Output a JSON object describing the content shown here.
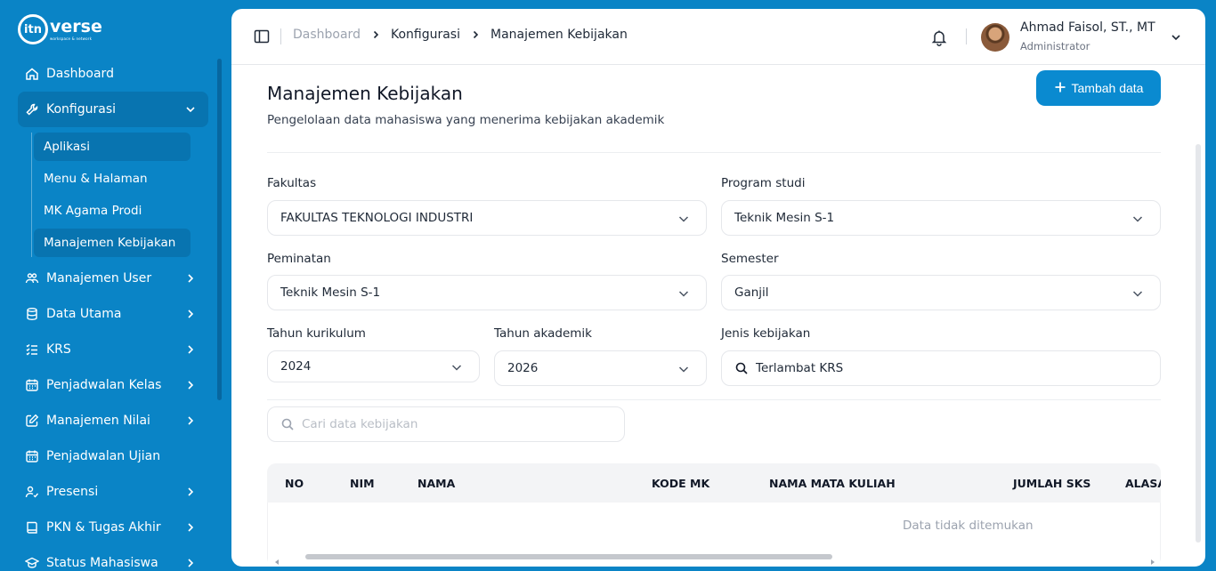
{
  "app": {
    "logo_text": "verse",
    "logo_sub": "workspace & network",
    "logo_mark": "itn"
  },
  "sidebar": {
    "items": [
      {
        "label": "Dashboard",
        "icon": "home-icon"
      },
      {
        "label": "Konfigurasi",
        "icon": "wrench-icon",
        "expanded": true
      },
      {
        "label": "Manajemen User",
        "icon": "users-icon"
      },
      {
        "label": "Data Utama",
        "icon": "database-icon"
      },
      {
        "label": "KRS",
        "icon": "checklist-icon"
      },
      {
        "label": "Penjadwalan Kelas",
        "icon": "calendar-icon"
      },
      {
        "label": "Manajemen Nilai",
        "icon": "edit-icon"
      },
      {
        "label": "Penjadwalan Ujian",
        "icon": "calendar-icon"
      },
      {
        "label": "Presensi",
        "icon": "user-check-icon"
      },
      {
        "label": "PKN & Tugas Akhir",
        "icon": "book-icon"
      },
      {
        "label": "Status Mahasiswa",
        "icon": "graduation-icon"
      }
    ],
    "sub_items": [
      {
        "label": "Aplikasi",
        "active": false
      },
      {
        "label": "Menu & Halaman",
        "active": false
      },
      {
        "label": "MK Agama Prodi",
        "active": false
      },
      {
        "label": "Manajemen Kebijakan",
        "active": true
      }
    ]
  },
  "header": {
    "breadcrumb": [
      "Dashboard",
      "Konfigurasi",
      "Manajemen Kebijakan"
    ],
    "user_name": "Ahmad Faisol, ST., MT",
    "user_role": "Administrator"
  },
  "page": {
    "title": "Manajemen Kebijakan",
    "subtitle": "Pengelolaan data mahasiswa yang menerima kebijakan akademik",
    "add_button": "Tambah data"
  },
  "filters": {
    "fakultas": {
      "label": "Fakultas",
      "value": "FAKULTAS TEKNOLOGI INDUSTRI"
    },
    "program_studi": {
      "label": "Program studi",
      "value": "Teknik Mesin S-1"
    },
    "peminatan": {
      "label": "Peminatan",
      "value": "Teknik Mesin S-1"
    },
    "semester": {
      "label": "Semester",
      "value": "Ganjil"
    },
    "tahun_kurikulum": {
      "label": "Tahun kurikulum",
      "value": "2024"
    },
    "tahun_akademik": {
      "label": "Tahun akademik",
      "value": "2026"
    },
    "jenis_kebijakan": {
      "label": "Jenis kebijakan",
      "value": "Terlambat KRS"
    }
  },
  "search": {
    "placeholder": "Cari data kebijakan"
  },
  "table": {
    "columns": [
      "NO",
      "NIM",
      "NAMA",
      "KODE MK",
      "NAMA MATA KULIAH",
      "JUMLAH SKS",
      "ALASAN"
    ],
    "rows": [],
    "empty_text": "Data tidak ditemukan"
  },
  "colors": {
    "primary": "#0a84c6",
    "button": "#0a8ad0",
    "active_nav": "#0874b0"
  }
}
